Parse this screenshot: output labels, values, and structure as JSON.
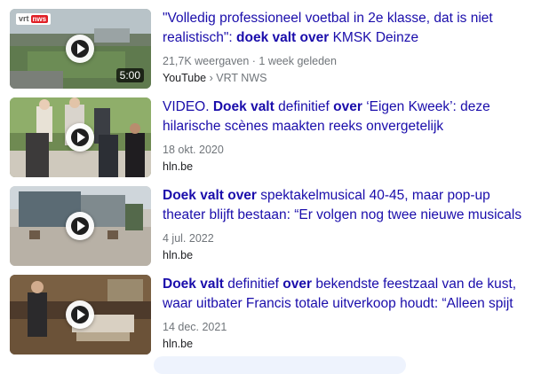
{
  "results": [
    {
      "title_line1": "\"Volledig professioneel voetbal in 2e klasse, dat is niet",
      "title_line2_prefix": "realistisch\": ",
      "title_line2_bold": "doek valt over",
      "title_line2_suffix": " KMSK Deinze",
      "meta": "21,7K weergaven · 1 week geleden",
      "source": "YouTube",
      "source_sep": " › ",
      "source_channel": "VRT NWS",
      "duration": "5:00",
      "brand_text": "vrt",
      "brand_badge": "nws"
    },
    {
      "l1a": "VIDEO. ",
      "l1b": "Doek valt",
      "l1c": " definitief ",
      "l1d": "over",
      "l1e": " ‘Eigen Kweek’: deze",
      "l2": "hilarische scènes maakten reeks onvergetelijk",
      "meta": "18 okt. 2020",
      "source": "hln.be"
    },
    {
      "l1a": "Doek valt over",
      "l1b": " spektakelmusical 40-45, maar pop-up",
      "l2": "theater blijft bestaan: “Er volgen nog twee nieuwe musicals",
      "meta": "4 jul. 2022",
      "source": "hln.be"
    },
    {
      "l1a": "Doek valt",
      "l1b": " definitief ",
      "l1c": "over",
      "l1d": " bekendste feestzaal van de kust,",
      "l2": "waar uitbater Francis totale uitverkoop houdt: “Alleen spijt",
      "meta": "14 dec. 2021",
      "source": "hln.be"
    }
  ],
  "colors": {
    "link": "#1a0dab",
    "meta": "#70757a",
    "source": "#202124"
  },
  "icons": [
    "play-icon"
  ]
}
